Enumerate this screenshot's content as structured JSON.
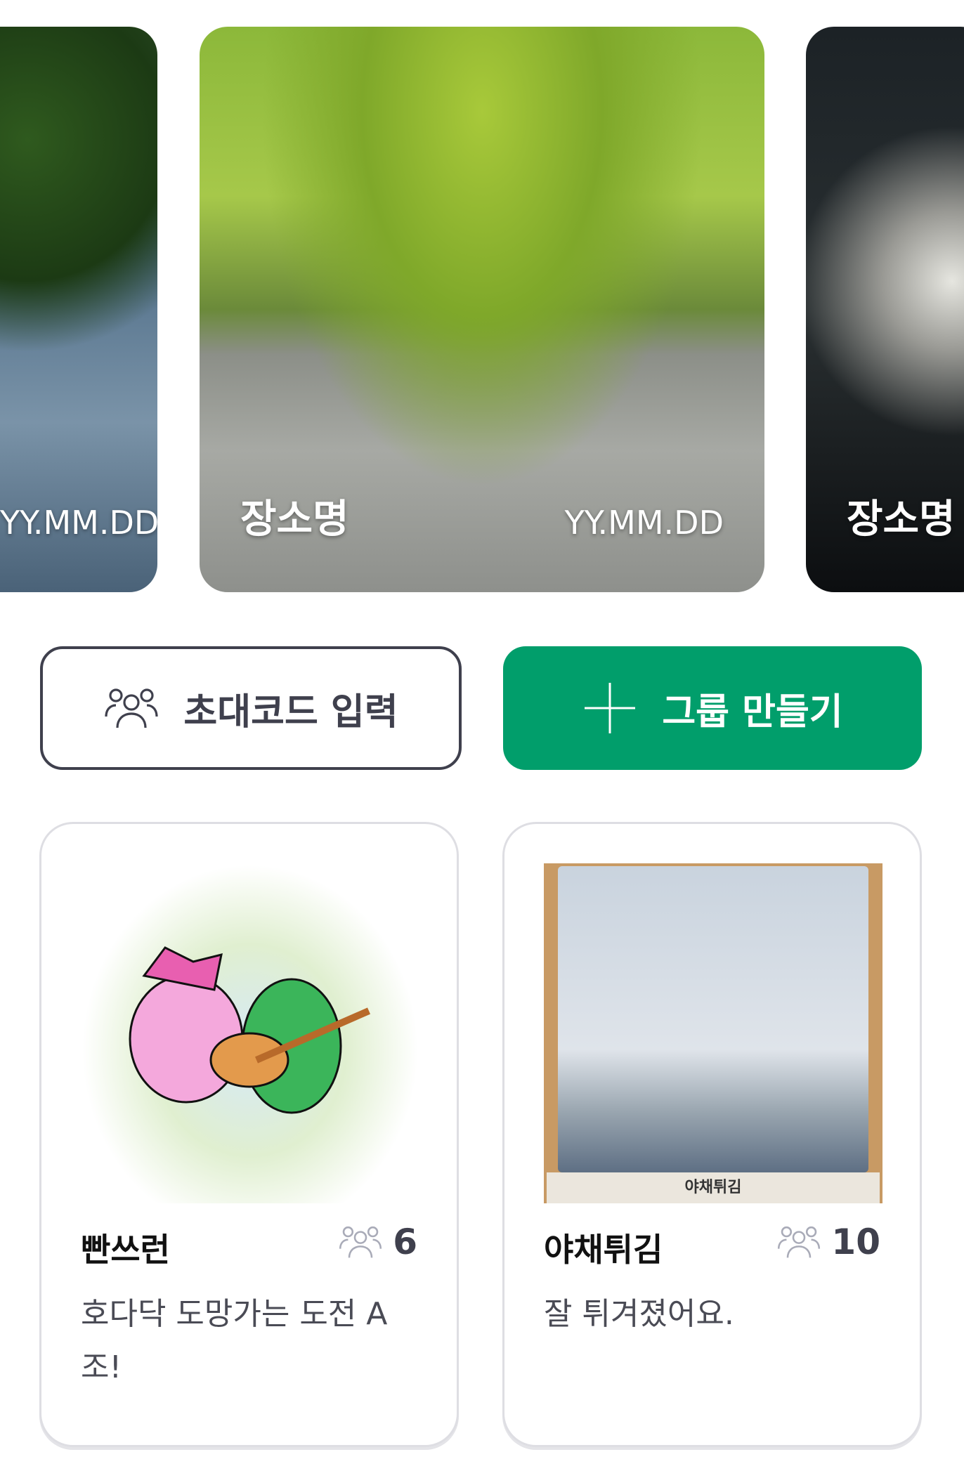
{
  "carousel": [
    {
      "place": "",
      "date": "YY.MM.DD"
    },
    {
      "place": "장소명",
      "date": "YY.MM.DD"
    },
    {
      "place": "장소명",
      "date": ""
    }
  ],
  "actions": {
    "invite_label": "초대코드 입력",
    "create_label": "그룹 만들기",
    "accent": "#019e6b"
  },
  "groups": [
    {
      "name": "빤쓰런",
      "members": "6",
      "description": "호다닥 도망가는 도전 A조!"
    },
    {
      "name": "야채튀김",
      "members": "10",
      "description": "잘 튀겨졌어요.",
      "image_caption": "야채튀김"
    }
  ]
}
